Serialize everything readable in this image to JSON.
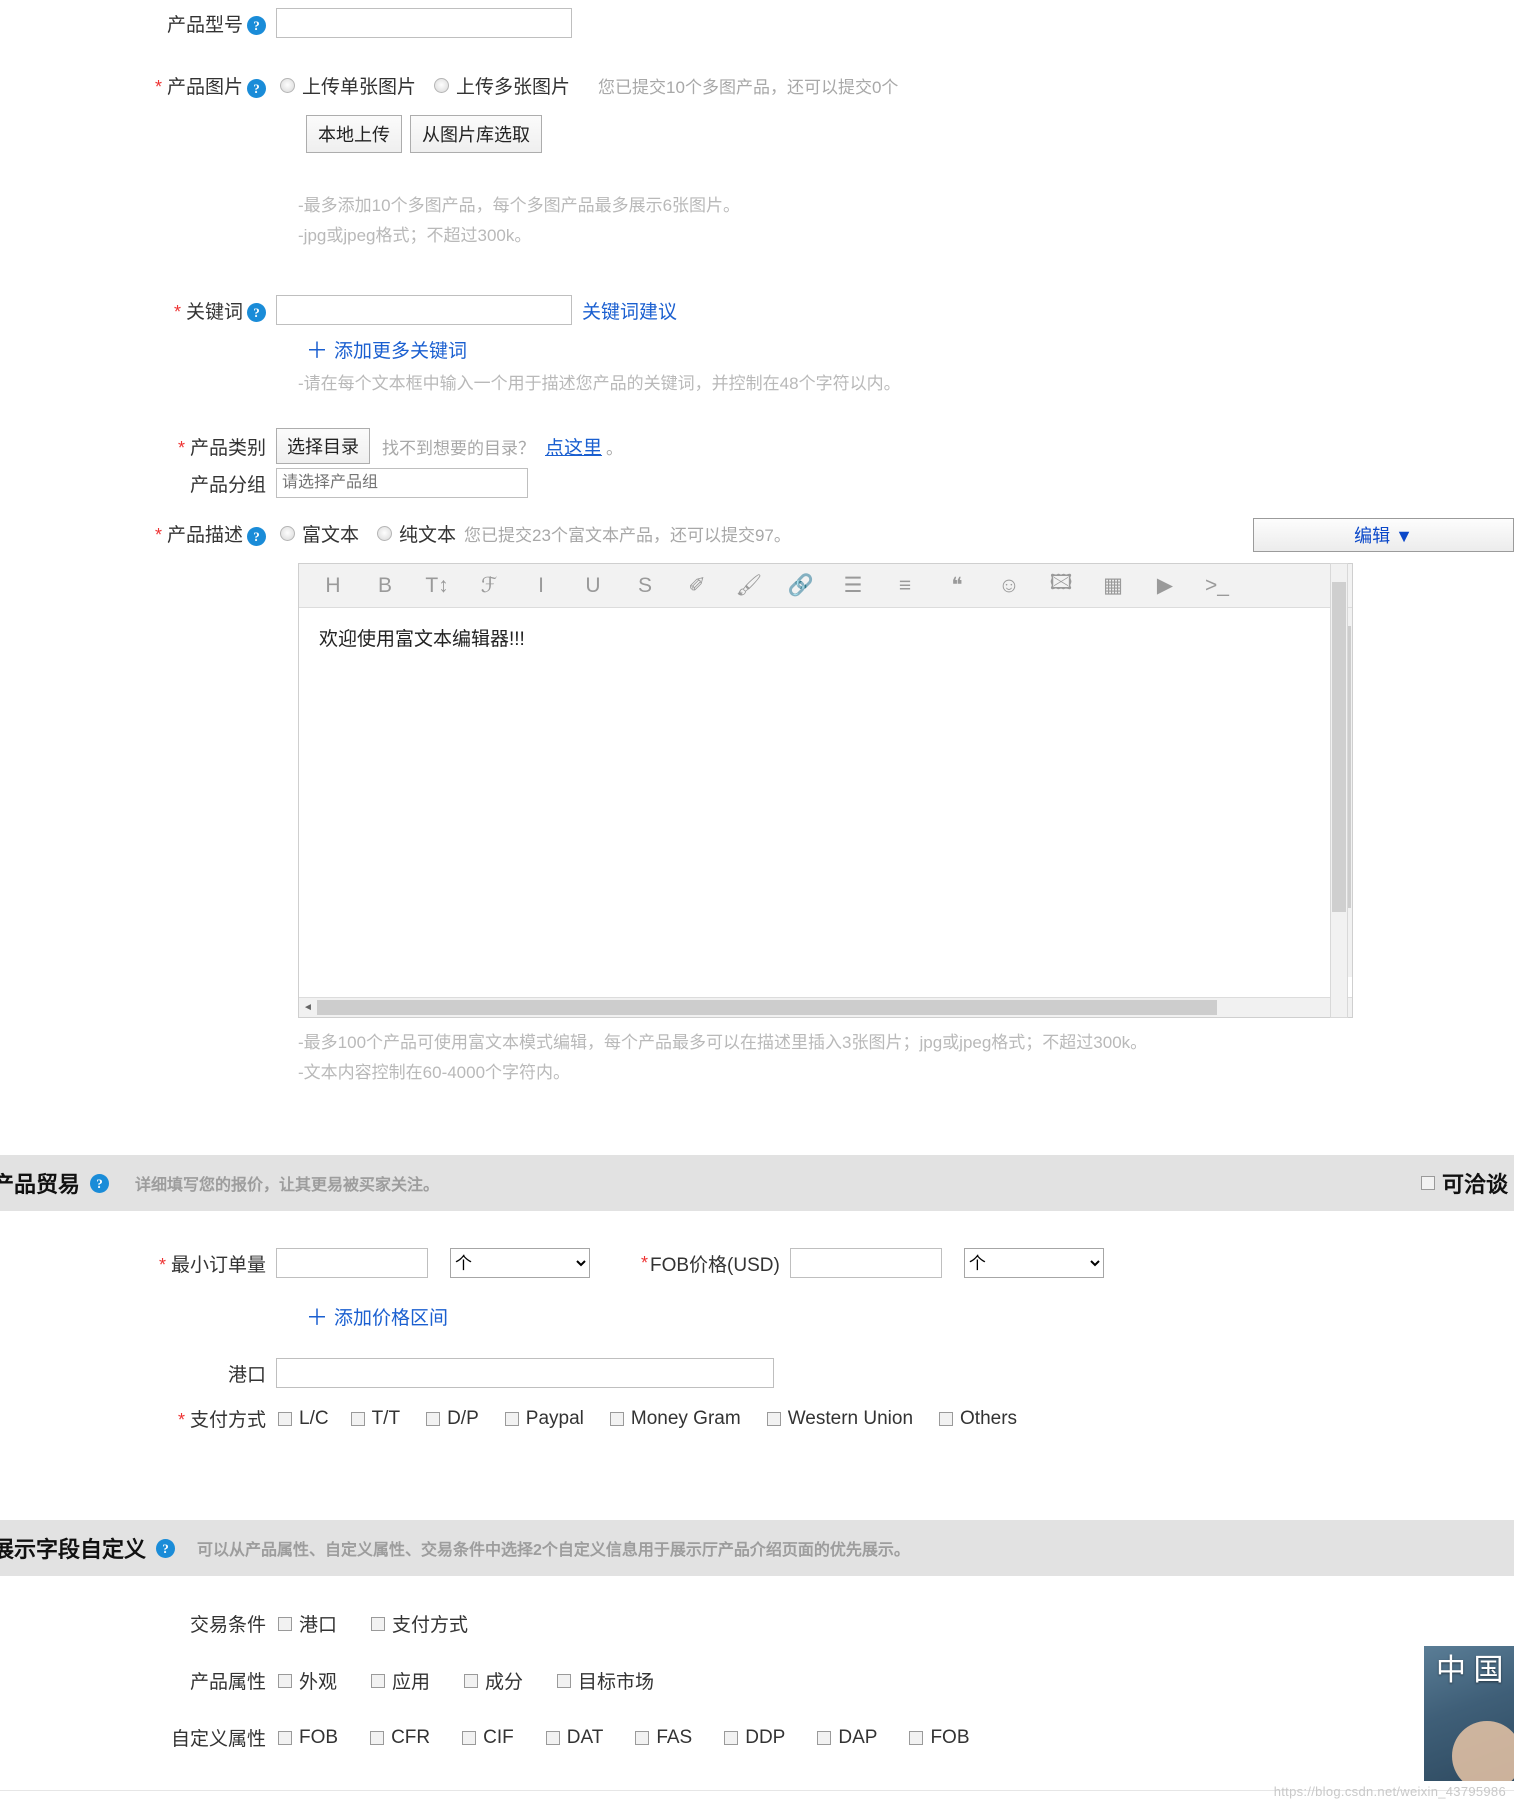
{
  "form": {
    "model": {
      "label": "产品型号",
      "value": "",
      "help": "help-icon"
    },
    "images": {
      "label": "产品图片",
      "required": "*",
      "radio_single": "上传单张图片",
      "radio_multi": "上传多张图片",
      "quota_note": "您已提交10个多图产品，还可以提交0个",
      "btn_local": "本地上传",
      "btn_library": "从图片库选取",
      "hint1": "-最多添加10个多图产品，每个多图产品最多展示6张图片。",
      "hint2": "-jpg或jpeg格式；不超过300k。"
    },
    "keywords": {
      "label": "关键词",
      "required": "*",
      "value": "",
      "suggest_link": "关键词建议",
      "add_more": "添加更多关键词",
      "plus": "＋",
      "hint": "-请在每个文本框中输入一个用于描述您产品的关键词，并控制在48个字符以内。"
    },
    "category": {
      "label": "产品类别",
      "required": "*",
      "btn_select": "选择目录",
      "note": "找不到想要的目录？",
      "link": "点这里",
      "period": "。"
    },
    "group": {
      "label": "产品分组",
      "placeholder": "请选择产品组",
      "value": ""
    },
    "description": {
      "label": "产品描述",
      "required": "*",
      "radio_rich": "富文本",
      "radio_plain": "纯文本",
      "quota_note": "您已提交23个富文本产品，还可以提交97。",
      "edit_button": "编辑 ▼",
      "editor_content": "欢迎使用富文本编辑器!!!",
      "toolbar_icons": [
        {
          "name": "heading-icon",
          "glyph": "H"
        },
        {
          "name": "bold-icon",
          "glyph": "B"
        },
        {
          "name": "font-size-icon",
          "glyph": "T↕"
        },
        {
          "name": "font-family-icon",
          "glyph": "ℱ"
        },
        {
          "name": "italic-icon",
          "glyph": "I"
        },
        {
          "name": "underline-icon",
          "glyph": "U"
        },
        {
          "name": "strikethrough-icon",
          "glyph": "S"
        },
        {
          "name": "eraser-icon",
          "glyph": "✐"
        },
        {
          "name": "brush-icon",
          "glyph": "🖌"
        },
        {
          "name": "link-icon",
          "glyph": "🔗"
        },
        {
          "name": "bullet-list-icon",
          "glyph": "☰"
        },
        {
          "name": "align-left-icon",
          "glyph": "≡"
        },
        {
          "name": "quote-icon",
          "glyph": "❝"
        },
        {
          "name": "emoji-icon",
          "glyph": "☺"
        },
        {
          "name": "image-icon",
          "glyph": "🖾"
        },
        {
          "name": "table-icon",
          "glyph": "▦"
        },
        {
          "name": "video-icon",
          "glyph": "▶"
        },
        {
          "name": "code-icon",
          "glyph": ">_"
        }
      ],
      "hint1": "-最多100个产品可使用富文本模式编辑，每个产品最多可以在描述里插入3张图片；jpg或jpeg格式；不超过300k。",
      "hint2": "-文本内容控制在60-4000个字符内。"
    }
  },
  "trade": {
    "title": "产品贸易",
    "subtitle": "详细填写您的报价，让其更易被买家关注。",
    "negotiable": "可洽谈",
    "moq": {
      "label": "最小订单量",
      "required": "*",
      "value": "",
      "unit_selected": "个"
    },
    "fob": {
      "label": "FOB价格(USD)",
      "required": "*",
      "value": "",
      "unit_selected": "个"
    },
    "add_price_range": "添加价格区间",
    "plus": "＋",
    "port": {
      "label": "港口",
      "value": ""
    },
    "payment": {
      "label": "支付方式",
      "required": "*",
      "options": [
        "L/C",
        "T/T",
        "D/P",
        "Paypal",
        "Money Gram",
        "Western Union",
        "Others"
      ]
    }
  },
  "display_fields": {
    "title": "展示字段自定义",
    "subtitle": "可以从产品属性、自定义属性、交易条件中选择2个自定义信息用于展示厅产品介绍页面的优先展示。",
    "rows": [
      {
        "label": "交易条件",
        "options": [
          "港口",
          "支付方式"
        ]
      },
      {
        "label": "产品属性",
        "options": [
          "外观",
          "应用",
          "成分",
          "目标市场"
        ]
      },
      {
        "label": "自定义属性",
        "options": [
          "FOB",
          "CFR",
          "CIF",
          "DAT",
          "FAS",
          "DDP",
          "DAP",
          "FOB"
        ]
      }
    ]
  },
  "watermark": {
    "url": "https://blog.csdn.net/weixin_43795986",
    "chars": "中 国"
  },
  "colors": {
    "accent": "#1a8cd8",
    "link": "#1a5fd0",
    "required": "#e33333",
    "banner_bg": "#e2e2e2",
    "hint": "#b9b9b9"
  }
}
